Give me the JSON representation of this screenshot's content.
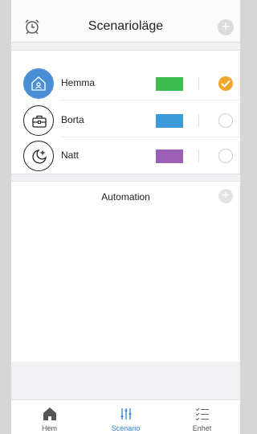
{
  "header": {
    "title": "Scenarioläge",
    "left_icon": "alarm-clock-icon",
    "right_icon": "plus-icon"
  },
  "scenarios": [
    {
      "name": "Hemma",
      "icon": "home-icon",
      "color": "#3ebd4e",
      "selected": true
    },
    {
      "name": "Borta",
      "icon": "briefcase-icon",
      "color": "#3d9ad9",
      "selected": false
    },
    {
      "name": "Natt",
      "icon": "moon-icon",
      "color": "#9b5fb6",
      "selected": false
    }
  ],
  "automation": {
    "label": "Automation"
  },
  "tabs": [
    {
      "label": "Hem",
      "icon": "home-icon",
      "active": false
    },
    {
      "label": "Scenario",
      "icon": "sliders-icon",
      "active": true
    },
    {
      "label": "Enhet",
      "icon": "checklist-icon",
      "active": false
    }
  ],
  "colors": {
    "accent": "#2f7fd8",
    "active_icon_bg": "#4a8fd6",
    "check": "#f3a52b"
  }
}
